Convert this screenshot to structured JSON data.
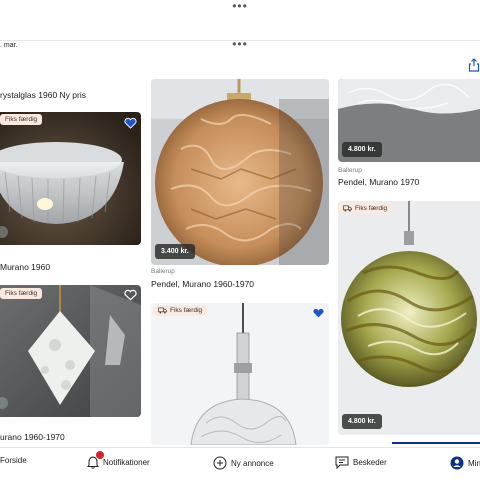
{
  "header": {
    "date": ". mar.",
    "drag_handle": "•••",
    "share_icon": "share-icon"
  },
  "cards": [
    {
      "id": "c1",
      "title": "rystalglas 1960 Ny pris",
      "badge": "Fiks færdig",
      "favorited": true
    },
    {
      "id": "c2",
      "title": "Murano 1960"
    },
    {
      "id": "c3",
      "title": "Pendel, Murano 1960-1970",
      "location": "Ballerup",
      "price": "3.400 kr."
    },
    {
      "id": "c4",
      "title": "Pendel, Murano 1970",
      "location": "Ballerup",
      "price": "4.800 kr."
    },
    {
      "id": "c5",
      "badge": "Fiks færdig",
      "price": "4.800 kr."
    },
    {
      "id": "c6",
      "title": "urano 1960-1970",
      "badge": "Fiks færdig",
      "favorited": false
    },
    {
      "id": "c7",
      "badge": "Fiks færdig",
      "favorited": true
    }
  ],
  "bottom_nav": {
    "items": [
      {
        "label": "Forside",
        "icon": "home-icon"
      },
      {
        "label": "Notifikationer",
        "icon": "bell-icon",
        "has_dot": true
      },
      {
        "label": "Ny annonce",
        "icon": "plus-circle-icon"
      },
      {
        "label": "Beskeder",
        "icon": "chat-icon"
      },
      {
        "label": "Min",
        "icon": "profile-icon",
        "active": true
      }
    ]
  },
  "colors": {
    "accent": "#0b2f8a",
    "heart": "#1e55c7",
    "badge_bg": "#fbe9dd",
    "notification": "#d8222a"
  }
}
